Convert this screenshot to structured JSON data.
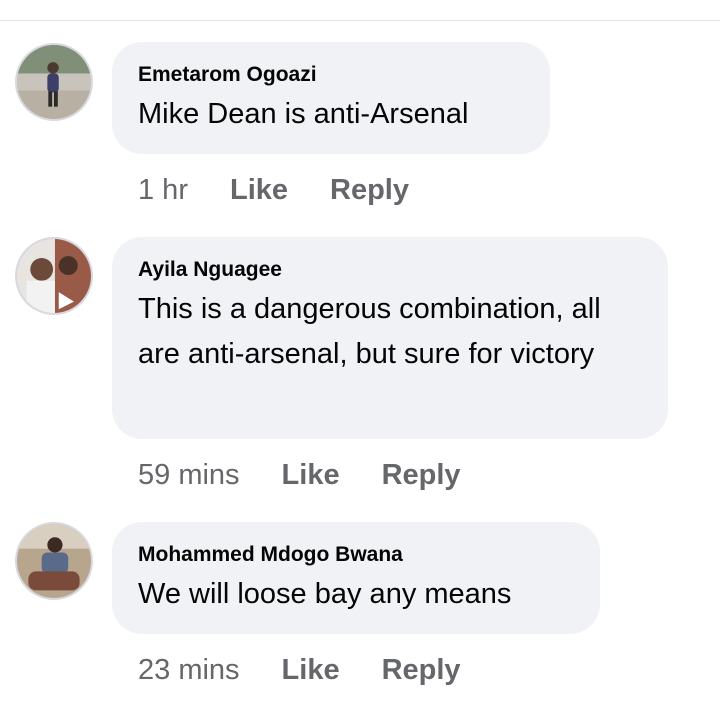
{
  "comments": [
    {
      "author": "Emetarom Ogoazi",
      "text": "Mike Dean is anti-Arsenal",
      "time": "1 hr",
      "like_label": "Like",
      "reply_label": "Reply"
    },
    {
      "author": "Ayila Nguagee",
      "text": "This is a dangerous combination, all are anti-arsenal, but sure for victory",
      "time": "59 mins",
      "like_label": "Like",
      "reply_label": "Reply"
    },
    {
      "author": "Mohammed Mdogo Bwana",
      "text": "We will loose bay any means",
      "time": "23 mins",
      "like_label": "Like",
      "reply_label": "Reply"
    }
  ],
  "colors": {
    "bubble": "#f0f2f5",
    "name_text": "#050505",
    "meta_text": "#65676b"
  }
}
